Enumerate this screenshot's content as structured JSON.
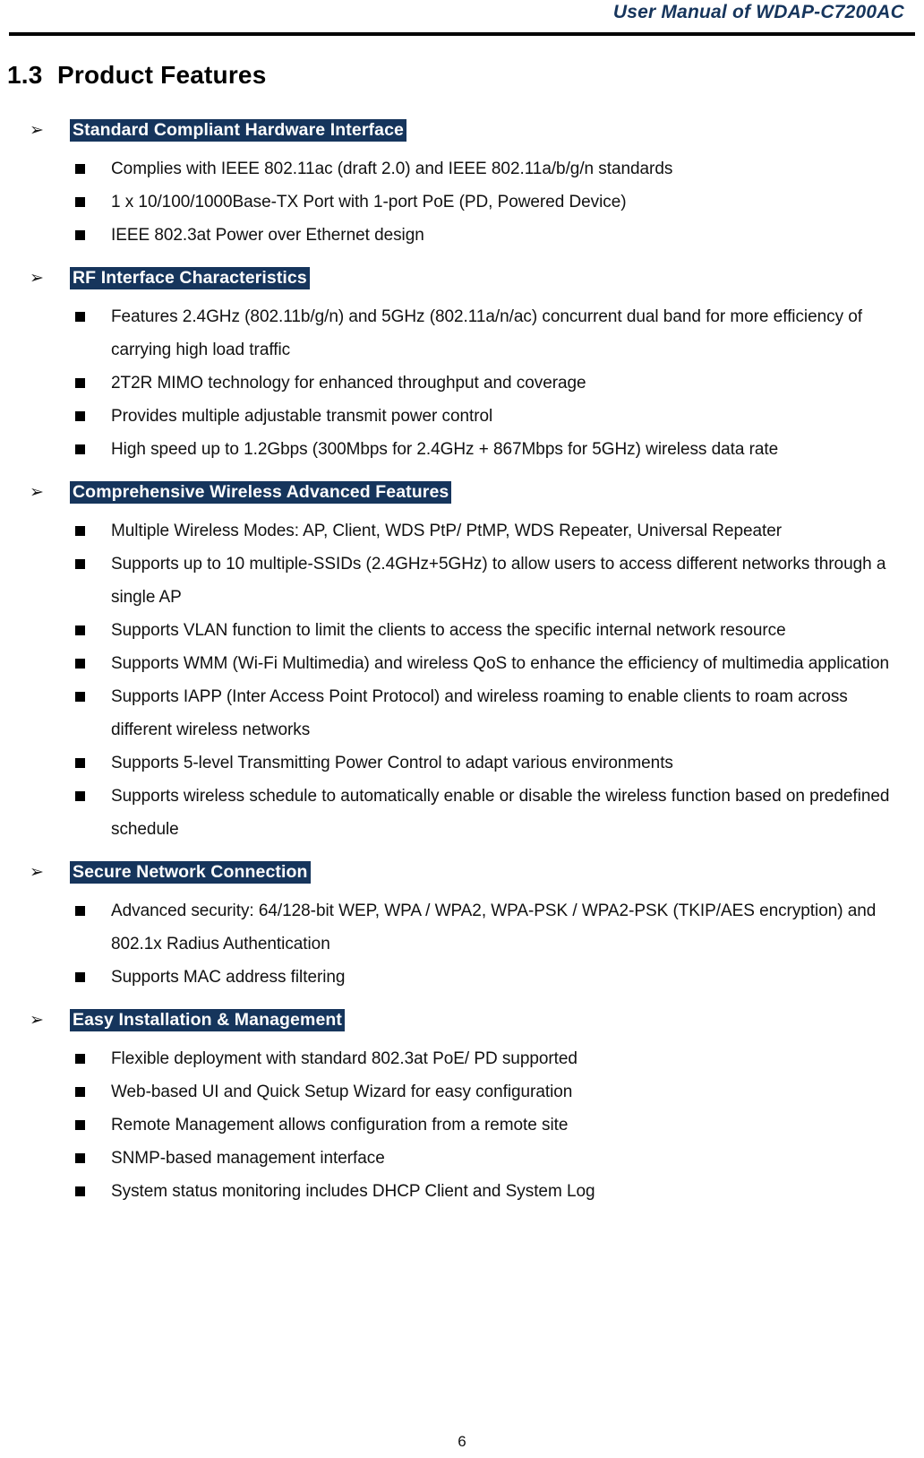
{
  "header": {
    "title": "User  Manual  of  WDAP-C7200AC"
  },
  "section": {
    "number": "1.3",
    "title": "Product Features"
  },
  "colors": {
    "heading_highlight_bg": "#16355c",
    "heading_highlight_text": "#ffffff",
    "header_title": "#16355c",
    "body_text": "#111111"
  },
  "icons": {
    "arrow_bullet": "➢",
    "square_bullet": "square-filled"
  },
  "groups": [
    {
      "title": "Standard Compliant Hardware Interface  ",
      "items": [
        "Complies with IEEE 802.11ac (draft 2.0) and IEEE 802.11a/b/g/n standards",
        "1 x 10/100/1000Base-TX Port with 1-port PoE (PD, Powered Device)",
        "IEEE 802.3at Power over Ethernet design"
      ]
    },
    {
      "title": "RF Interface Characteristics",
      "items": [
        "Features 2.4GHz (802.11b/g/n) and 5GHz (802.11a/n/ac) concurrent dual band for more efficiency of carrying high load traffic",
        "2T2R MIMO technology for enhanced throughput and coverage",
        "Provides multiple adjustable transmit power control",
        "High speed up to 1.2Gbps (300Mbps for 2.4GHz + 867Mbps for 5GHz) wireless data rate"
      ]
    },
    {
      "title": "Comprehensive Wireless Advanced Features",
      "items": [
        "Multiple Wireless Modes: AP, Client, WDS PtP/ PtMP, WDS Repeater, Universal Repeater",
        "Supports up to 10 multiple-SSIDs (2.4GHz+5GHz) to allow users to access different networks through a single AP",
        "Supports VLAN function to limit the clients to access the specific internal network resource",
        "Supports WMM (Wi-Fi Multimedia) and wireless QoS to enhance the efficiency of multimedia application",
        "Supports IAPP (Inter Access Point Protocol) and wireless roaming to enable clients to roam across different wireless networks",
        "Supports 5-level Transmitting Power Control to adapt various environments",
        "Supports wireless schedule to automatically enable or disable the wireless function based on predefined schedule"
      ]
    },
    {
      "title": "Secure Network Connection",
      "items": [
        "Advanced security: 64/128-bit WEP, WPA / WPA2, WPA-PSK / WPA2-PSK (TKIP/AES encryption) and 802.1x Radius Authentication",
        "Supports MAC address filtering"
      ]
    },
    {
      "title": "Easy Installation & Management",
      "items": [
        "Flexible deployment with standard 802.3at PoE/ PD supported",
        "Web-based UI and Quick Setup Wizard for easy configuration",
        "Remote Management allows configuration from a remote site",
        "SNMP-based management interface",
        "System status monitoring includes DHCP Client and System Log"
      ]
    }
  ],
  "footer": {
    "page_number": "6"
  }
}
